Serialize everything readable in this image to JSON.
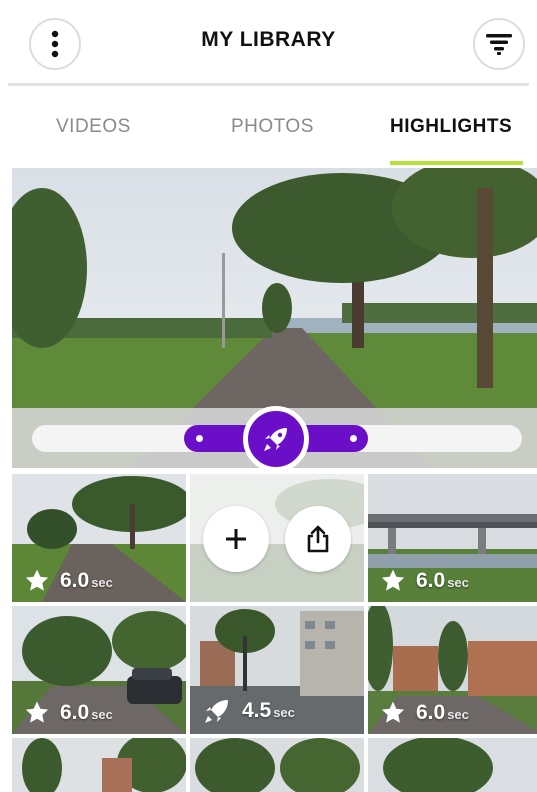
{
  "header": {
    "title": "MY LIBRARY",
    "menu_icon": "more-vertical-icon",
    "filter_icon": "filter-icon"
  },
  "tabs": [
    {
      "label": "VIDEOS",
      "active": false
    },
    {
      "label": "PHOTOS",
      "active": false
    },
    {
      "label": "HIGHLIGHTS",
      "active": true
    }
  ],
  "colors": {
    "accent_purple": "#6a0fc7",
    "tab_underline": "#b8e23a"
  },
  "hero": {
    "slider_icon": "rocket-icon"
  },
  "grid": [
    {
      "value": "6.0",
      "unit": "sec",
      "icon": "star-icon"
    },
    {
      "actions": [
        "add-icon",
        "share-icon"
      ]
    },
    {
      "value": "6.0",
      "unit": "sec",
      "icon": "star-icon"
    },
    {
      "value": "6.0",
      "unit": "sec",
      "icon": "star-icon"
    },
    {
      "value": "4.5",
      "unit": "sec",
      "icon": "rocket-icon"
    },
    {
      "value": "6.0",
      "unit": "sec",
      "icon": "star-icon"
    }
  ]
}
